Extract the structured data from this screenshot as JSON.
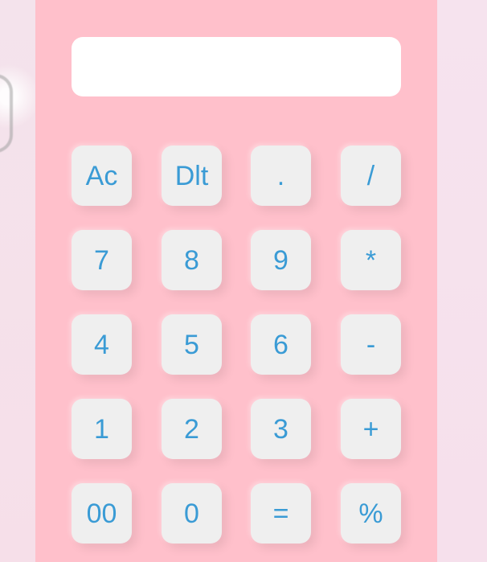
{
  "calculator": {
    "display": {
      "value": "",
      "placeholder": ""
    },
    "rows": [
      [
        "Ac",
        "Dlt",
        ".",
        "/"
      ],
      [
        "7",
        "8",
        "9",
        "*"
      ],
      [
        "4",
        "5",
        "6",
        "-"
      ],
      [
        "1",
        "2",
        "3",
        "+"
      ],
      [
        "00",
        "0",
        "=",
        "%"
      ]
    ]
  },
  "colors": {
    "panel": "#ffc0cb",
    "key_bg": "#efefef",
    "key_text": "#3a9bd5",
    "display_bg": "#ffffff"
  }
}
